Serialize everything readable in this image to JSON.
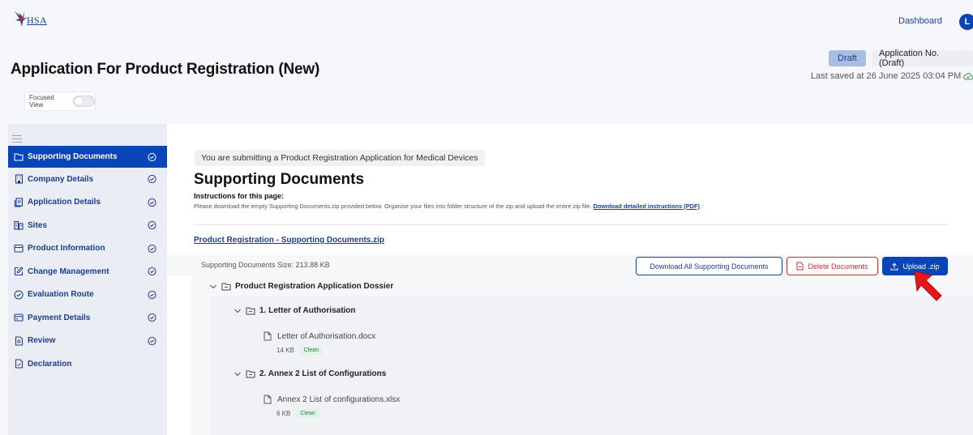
{
  "header": {
    "logo_text": "HSA",
    "dashboard_label": "Dashboard",
    "avatar_initial": "L"
  },
  "page": {
    "title": "Application For Product Registration (New)",
    "status": "Draft",
    "application_no": "Application No. (Draft)",
    "last_saved": "Last saved at 26 June 2025 03:04 PM",
    "focused_view_label": "Focused View"
  },
  "sidebar": {
    "items": [
      {
        "label": "Supporting Documents",
        "icon": "folder-icon",
        "checked": true,
        "active": true
      },
      {
        "label": "Company Details",
        "icon": "building-icon",
        "checked": true
      },
      {
        "label": "Application Details",
        "icon": "document-stack-icon",
        "checked": true
      },
      {
        "label": "Sites",
        "icon": "sites-icon",
        "checked": true
      },
      {
        "label": "Product Information",
        "icon": "box-icon",
        "checked": true
      },
      {
        "label": "Change Management",
        "icon": "edit-icon",
        "checked": true
      },
      {
        "label": "Evaluation Route",
        "icon": "check-circle-icon",
        "checked": true
      },
      {
        "label": "Payment Details",
        "icon": "card-icon",
        "checked": true
      },
      {
        "label": "Review",
        "icon": "review-icon",
        "checked": true
      },
      {
        "label": "Declaration",
        "icon": "declaration-icon",
        "checked": false
      }
    ]
  },
  "main": {
    "banner": "You are submitting a Product Registration Application for Medical Devices",
    "section_title": "Supporting Documents",
    "instructions_heading": "Instructions for this page:",
    "instructions_text": "Please download the empty Supporting Documents.zip provided below. Organise your files into folder structure of the zip and upload the entire zip file.",
    "instructions_link": "Download detailed instructions (PDF)",
    "zip_link": "Product Registration - Supporting Documents.zip",
    "size_text": "Supporting Documents Size: 213.88 KB",
    "buttons": {
      "download_all": "Download All Supporting Documents",
      "delete": "Delete Documents",
      "upload": "Upload .zip"
    },
    "tree": {
      "root": "Product Registration Application Dossier",
      "folders": [
        {
          "name": "1. Letter of Authorisation",
          "file": "Letter of Authorisation.docx",
          "size": "14 KB",
          "status": "Clean"
        },
        {
          "name": "2. Annex 2 List of Configurations",
          "file": "Annex 2 List of configurations.xlsx",
          "size": "6 KB",
          "status": "Clean"
        }
      ]
    }
  },
  "colors": {
    "primary": "#0a45b8",
    "link": "#1d3e8f",
    "danger": "#c9302c",
    "clean_badge_bg": "#dff4e4",
    "cursor": "#e8141c"
  }
}
